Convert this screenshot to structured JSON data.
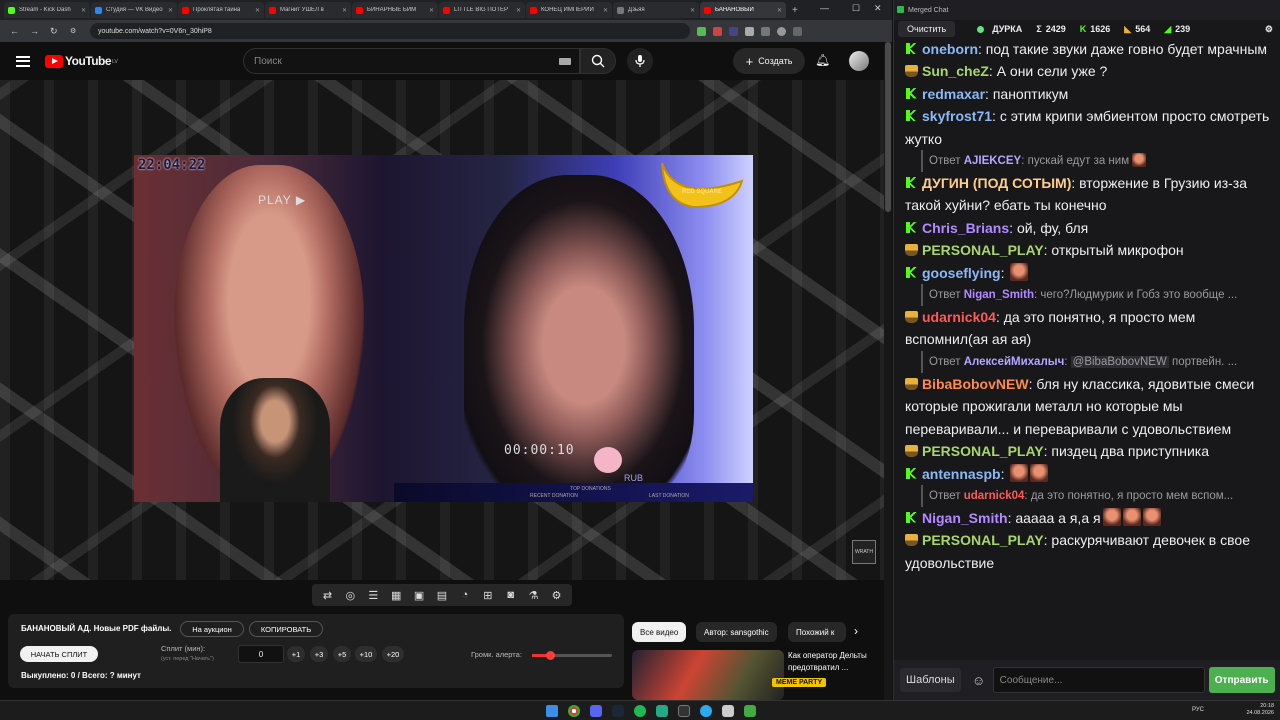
{
  "browser": {
    "tabs": [
      {
        "label": "Stream - Kick Dash",
        "fav": "#53fc18"
      },
      {
        "label": "Студия — VK Видео",
        "fav": "#2787f5"
      },
      {
        "label": "Проклятая тайна",
        "fav": "#ff0000"
      },
      {
        "label": "Магнит УШЁЛ в",
        "fav": "#ff0000"
      },
      {
        "label": "БИНАРНЫЕ БИМ",
        "fav": "#ff0000"
      },
      {
        "label": "LITTLE BIG ПОТЕР",
        "fav": "#ff0000"
      },
      {
        "label": "КОНЕЦ ИМПЕРИИ",
        "fav": "#ff0000"
      },
      {
        "label": "Дзьяя",
        "fav": "#777777"
      },
      {
        "label": "БАНАНОВЫЙ",
        "fav": "#ff0000"
      }
    ],
    "url": "youtube.com/watch?v=0V6n_30hiP8"
  },
  "youtube": {
    "logo": "YouTube",
    "region": "LV",
    "search_placeholder": "Поиск",
    "create_label": "Создать"
  },
  "video": {
    "timestamp": "22:04:22",
    "osd_play": "PLAY ▶",
    "brand": "RED SQUARE",
    "timer": "00:00:10",
    "rub": "RUB",
    "top_donations": "TOP DONATIONS",
    "recent_donation": "RECENT DONATION",
    "last_donation": "LAST DONATION",
    "overlay_logo": "WRATH"
  },
  "panel": {
    "title": "БАНАНОВЫЙ АД. Новые PDF файлы.",
    "auction_label": "На аукцион",
    "copy_label": "КОПИРОВАТЬ",
    "start_split_label": "НАЧАТЬ СПЛИТ",
    "split_label": "Сплит (мин):",
    "split_hint": "(уст. перед \"Начать\")",
    "minutes_value": "0",
    "inc_buttons": [
      "+1",
      "+3",
      "+5",
      "+10",
      "+20"
    ],
    "volume_label": "Громк. алерта:",
    "volume_level": 0.22,
    "bought_text": "Выкуплено: 0 / Всего: ? минут"
  },
  "recommendations": {
    "chips": [
      "Все видео",
      "Автор: sansgothic",
      "Похожий к"
    ],
    "item_title": "Как оператор Дельты предотвратил ...",
    "item_tag": "MEME PARTY"
  },
  "chat": {
    "window_title": "Merged Chat",
    "clear_label": "Очистить",
    "streamer": "ДУРКА",
    "stats": [
      {
        "icon": "sum-icon",
        "glyph": "Σ",
        "value": "2429"
      },
      {
        "icon": "kick-icon",
        "glyph": "K",
        "value": "1626"
      },
      {
        "icon": "twitch-icon",
        "glyph": "◣",
        "value": "564"
      },
      {
        "icon": "vk-icon",
        "glyph": "◢",
        "value": "239"
      }
    ],
    "templates_label": "Шаблоны",
    "input_placeholder": "Сообщение...",
    "send_label": "Отправить",
    "messages": [
      {
        "type": "msg",
        "badge": "k",
        "nick": "oneborn",
        "color": "#8bb9f5",
        "text": "под такие звуки даже говно будет мрачным"
      },
      {
        "type": "msg",
        "badge": "tr",
        "nick": "Sun_cheZ",
        "color": "#a8d66a",
        "text": "А они сели уже ?"
      },
      {
        "type": "msg",
        "badge": "k",
        "nick": "redmaxar",
        "color": "#8bb9f5",
        "text": "паноптикум"
      },
      {
        "type": "msg",
        "badge": "k",
        "nick": "skyfrost71",
        "color": "#8bb9f5",
        "text": "с этим крипи эмбиентом просто смотреть жутко"
      },
      {
        "type": "reply",
        "prefix": "Ответ",
        "rnick": "AJIEKCEY",
        "rcolor": "#b5a6ff",
        "text": "пускай едут за ним",
        "emote": true
      },
      {
        "type": "msg",
        "badge": "k",
        "nick": "ДУГИН (ПОД СОТЫМ)",
        "color": "#ffcf8a",
        "text": "вторжение в Грузию из-за такой хуйни? ебать ты конечно"
      },
      {
        "type": "msg",
        "badge": "k",
        "nick": "Chris_Brians",
        "color": "#b38aff",
        "text": "ой, фу, бля"
      },
      {
        "type": "msg",
        "badge": "tr",
        "nick": "PERSONAL_PLAY",
        "color": "#a8d66a",
        "text": "открытый микрофон"
      },
      {
        "type": "msg",
        "badge": "k",
        "nick": "gooseflying",
        "color": "#8bb9f5",
        "text": "",
        "emote": true
      },
      {
        "type": "reply",
        "prefix": "Ответ",
        "rnick": "Nigan_Smith",
        "rcolor": "#b38aff",
        "text": "чего?Людмурик и Гобз это вообще ..."
      },
      {
        "type": "msg",
        "badge": "tr",
        "nick": "udarnick04",
        "color": "#ff5a5a",
        "text": "да это понятно, я просто мем вспомнил(ая ая ая)"
      },
      {
        "type": "reply",
        "prefix": "Ответ",
        "rnick": "АлексейМихалыч",
        "rcolor": "#b5a6ff",
        "mention": "@BibaBobovNEW",
        "text": "портвейн. ..."
      },
      {
        "type": "msg",
        "badge": "tr",
        "nick": "BibaBobovNEW",
        "color": "#ff8a4a",
        "text": "бля ну классика, ядовитые смеси которые прожигали металл но которые мы переваривали... и переваривали с удовольствием"
      },
      {
        "type": "msg",
        "badge": "tr",
        "nick": "PERSONAL_PLAY",
        "color": "#a8d66a",
        "text": "пиздец два приступника"
      },
      {
        "type": "msg",
        "badge": "k",
        "nick": "antennaspb",
        "color": "#8bb9f5",
        "text": "",
        "emote": true,
        "emote2": true
      },
      {
        "type": "reply",
        "prefix": "Ответ",
        "rnick": "udarnick04",
        "rcolor": "#ff5a5a",
        "text": "да это понятно, я просто мем вспом..."
      },
      {
        "type": "msg",
        "badge": "k",
        "nick": "Nigan_Smith",
        "color": "#b38aff",
        "text": "ааааа а я,а я",
        "emote": true,
        "emote2": true,
        "emote3": true
      },
      {
        "type": "msg",
        "badge": "tr",
        "nick": "PERSONAL_PLAY",
        "color": "#a8d66a",
        "text": "раскурячивают девочек в свое удовольствие"
      }
    ]
  },
  "taskbar": {
    "lang": "РУС",
    "time": "20:18",
    "date": "24.08.2026"
  }
}
